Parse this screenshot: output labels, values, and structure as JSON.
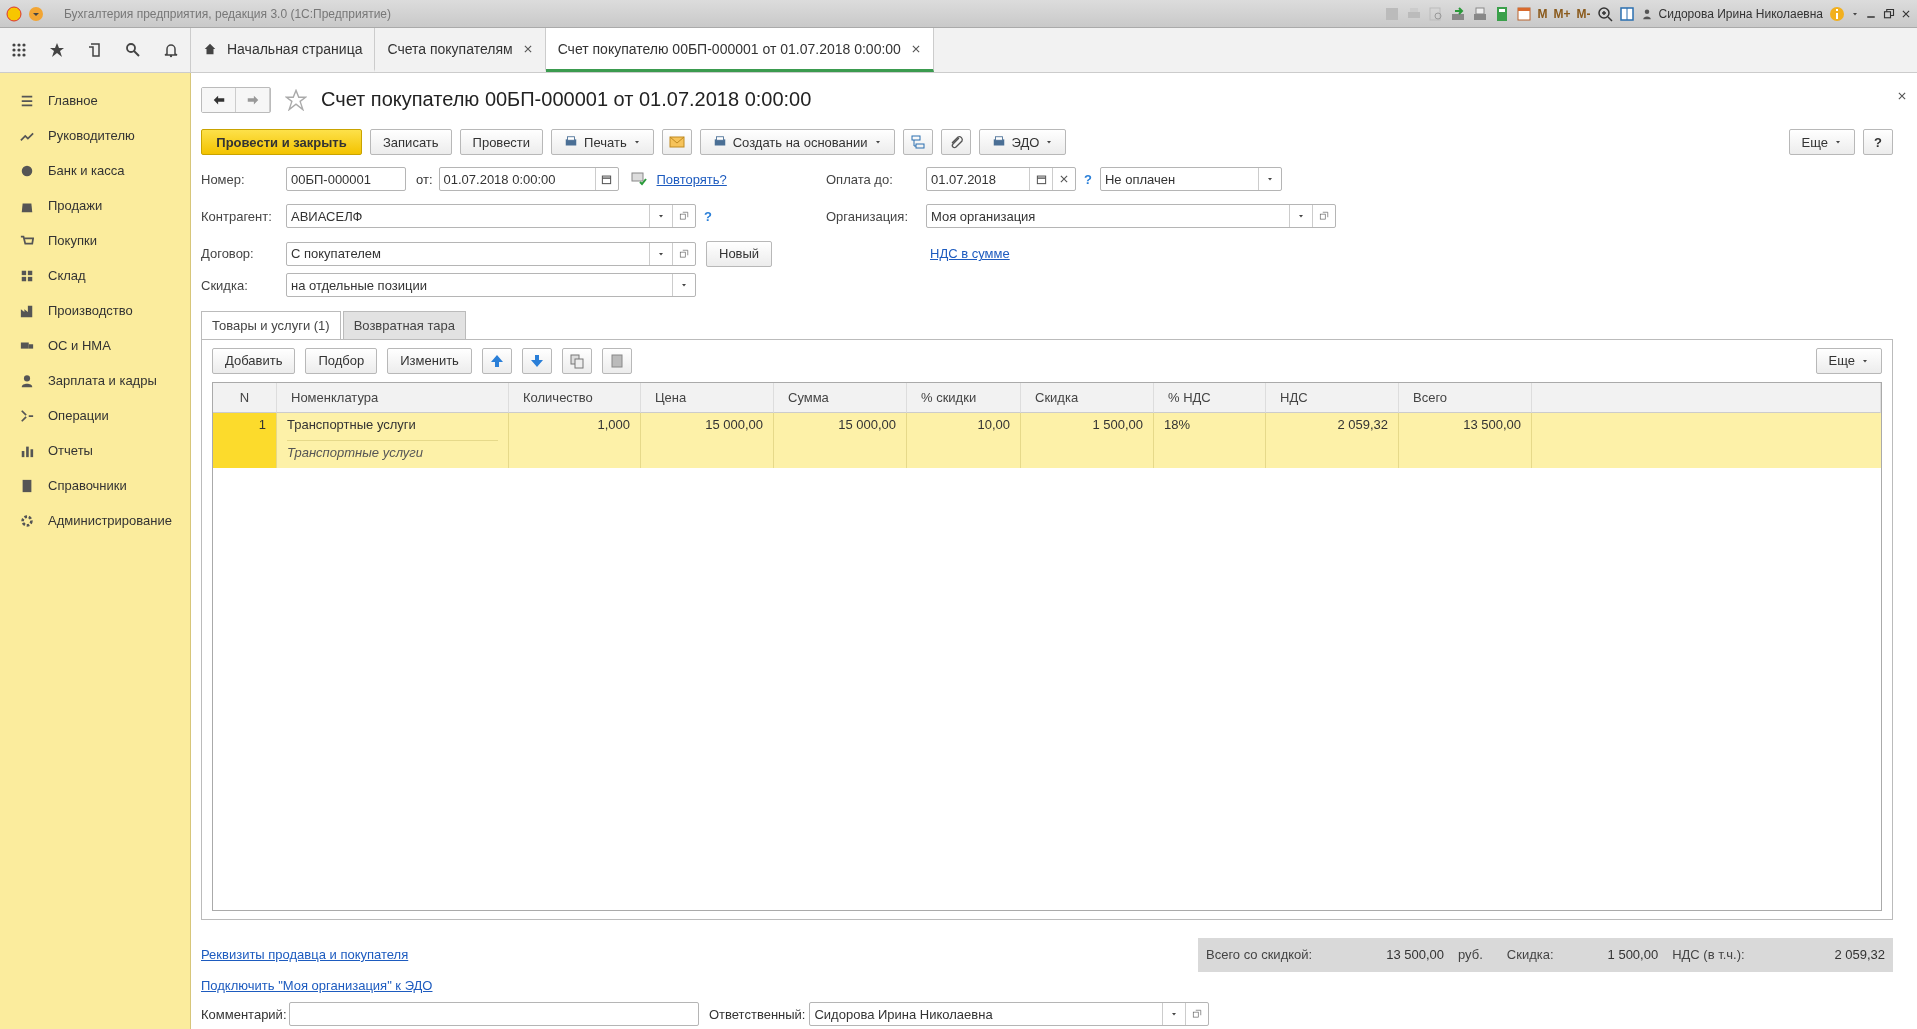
{
  "title_bar": {
    "app_title": "Бухгалтерия предприятия, редакция 3.0  (1С:Предприятие)",
    "memory_buttons": [
      "M",
      "M+",
      "M-"
    ],
    "user": "Сидорова Ирина Николаевна"
  },
  "open_tabs": [
    {
      "label": "Начальная страница",
      "selected": false,
      "closable": false
    },
    {
      "label": "Счета покупателям",
      "selected": false,
      "closable": true
    },
    {
      "label": "Счет покупателю 00БП-000001 от 01.07.2018 0:00:00",
      "selected": true,
      "closable": true
    }
  ],
  "sidebar": {
    "items": [
      {
        "label": "Главное"
      },
      {
        "label": "Руководителю"
      },
      {
        "label": "Банк и касса"
      },
      {
        "label": "Продажи"
      },
      {
        "label": "Покупки"
      },
      {
        "label": "Склад"
      },
      {
        "label": "Производство"
      },
      {
        "label": "ОС и НМА"
      },
      {
        "label": "Зарплата и кадры"
      },
      {
        "label": "Операции"
      },
      {
        "label": "Отчеты"
      },
      {
        "label": "Справочники"
      },
      {
        "label": "Администрирование"
      }
    ]
  },
  "form": {
    "title": "Счет покупателю 00БП-000001 от 01.07.2018 0:00:00",
    "toolbar": [
      {
        "kind": "primary",
        "label": "Провести и закрыть"
      },
      {
        "kind": "button",
        "label": "Записать"
      },
      {
        "kind": "button",
        "label": "Провести"
      },
      {
        "kind": "menu",
        "label": "Печать"
      },
      {
        "kind": "icon"
      },
      {
        "kind": "menu",
        "label": "Создать на основании"
      },
      {
        "kind": "icon"
      },
      {
        "kind": "icon"
      },
      {
        "kind": "menu",
        "label": "ЭДО"
      }
    ],
    "more": "Еще",
    "help": "?",
    "number": {
      "label": "Номер:",
      "value": "00БП-000001"
    },
    "date": {
      "label": "от:",
      "value": "01.07.2018  0:00:00"
    },
    "repeat_link": "Повторять?",
    "payment_due": {
      "label": "Оплата до:",
      "value": "01.07.2018",
      "hint": "?"
    },
    "payment_status": {
      "value": "Не оплачен"
    },
    "counterparty": {
      "label": "Контрагент:",
      "value": "АВИАСЕЛФ",
      "hint": "?"
    },
    "organization": {
      "label": "Организация:",
      "value": "Моя организация"
    },
    "contract": {
      "label": "Договор:",
      "value": "С покупателем"
    },
    "new_button": "Новый",
    "vat_link": "НДС в сумме",
    "discount": {
      "label": "Скидка:",
      "value": "на отдельные позиции"
    },
    "inner_tabs": [
      {
        "label": "Товары и услуги (1)",
        "selected": true
      },
      {
        "label": "Возвратная тара",
        "selected": false
      }
    ],
    "table_toolbar": [
      {
        "kind": "button",
        "label": "Добавить"
      },
      {
        "kind": "button",
        "label": "Подбор"
      },
      {
        "kind": "button",
        "label": "Изменить"
      },
      {
        "kind": "icon"
      },
      {
        "kind": "icon"
      },
      {
        "kind": "icon"
      },
      {
        "kind": "icon"
      }
    ],
    "table_more": "Еще",
    "table": {
      "columns": [
        "N",
        "Номенклатура",
        "Количество",
        "Цена",
        "Сумма",
        "% скидки",
        "Скидка",
        "% НДС",
        "НДС",
        "Всего"
      ],
      "rows": [
        {
          "selected": true,
          "cells": [
            "1",
            "Транспортные услуги",
            "1,000",
            "15 000,00",
            "15 000,00",
            "10,00",
            "1 500,00",
            "18%",
            "2 059,32",
            "13 500,00"
          ],
          "subtitle": "Транспортные услуги"
        }
      ]
    },
    "footer": {
      "links": [
        "Реквизиты продавца и покупателя",
        "Подключить \"Моя организация\" к ЭДО"
      ],
      "totals": {
        "total_label": "Всего со скидкой:",
        "total": "13 500,00",
        "currency": "руб.",
        "discount_label": "Скидка:",
        "discount": "1 500,00",
        "vat_label": "НДС (в т.ч.):",
        "vat": "2 059,32"
      },
      "comment": {
        "label": "Комментарий:"
      },
      "responsible": {
        "label": "Ответственный:",
        "value": "Сидорова Ирина Николаевна"
      }
    }
  }
}
